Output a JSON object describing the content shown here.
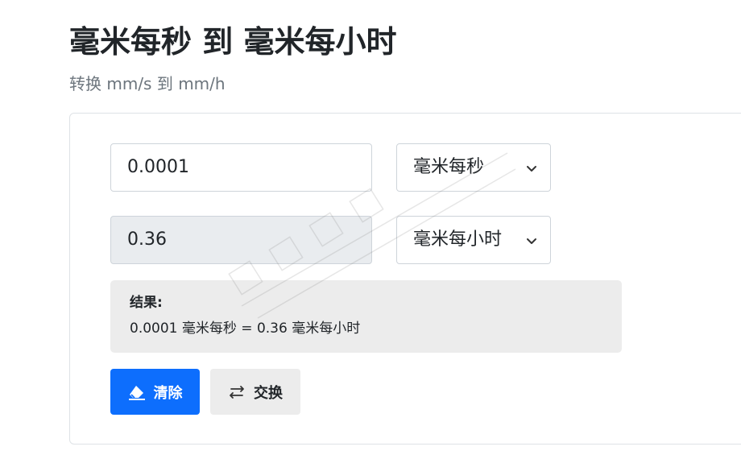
{
  "header": {
    "title": "毫米每秒 到 毫米每小时",
    "subtitle": "转换 mm/s 到 mm/h"
  },
  "converter": {
    "from_value": "0.0001",
    "from_unit": "毫米每秒",
    "to_value": "0.36",
    "to_unit": "毫米每小时"
  },
  "result": {
    "label": "结果:",
    "text": "0.0001 毫米每秒 = 0.36 毫米每小时"
  },
  "buttons": {
    "clear_label": "清除",
    "swap_label": "交换"
  },
  "icons": {
    "clear": "eraser-icon",
    "swap": "swap-arrows-icon",
    "dropdown": "chevron-down-icon"
  },
  "colors": {
    "primary": "#0d6efd",
    "readonly_bg": "#e9ecef",
    "result_bg": "#ececec"
  }
}
